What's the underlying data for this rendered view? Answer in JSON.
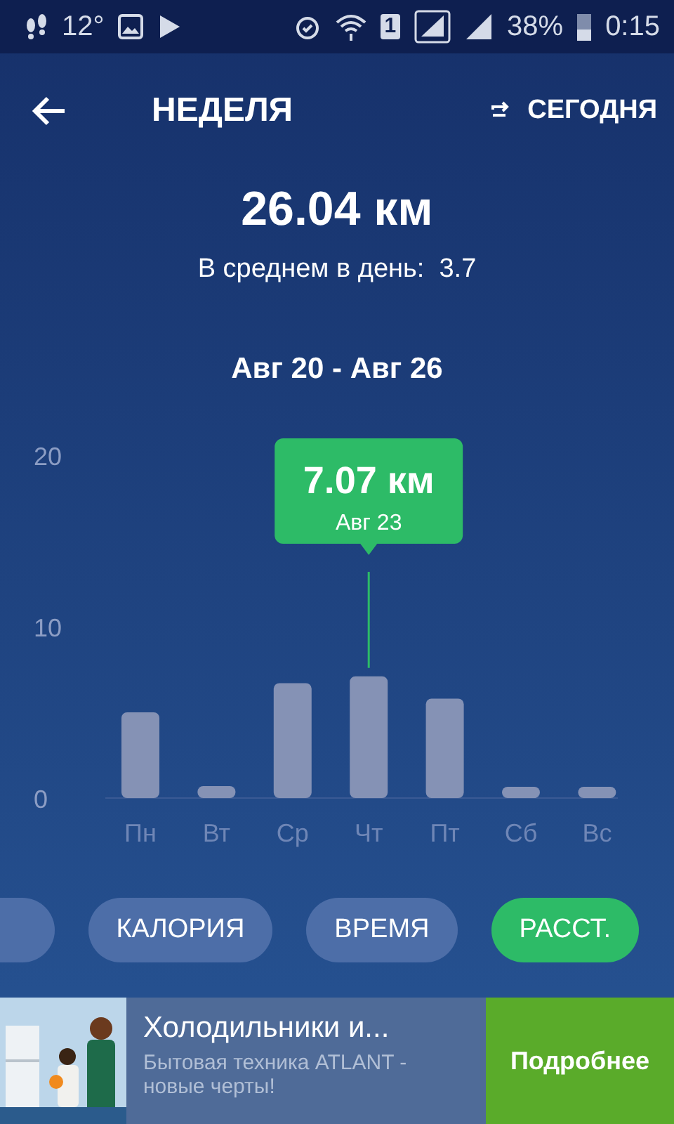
{
  "status_bar": {
    "temperature": "12°",
    "sim": "1",
    "battery": "38%",
    "time": "0:15"
  },
  "header": {
    "title": "НЕДЕЛЯ",
    "today_button": "СЕГОДНЯ"
  },
  "summary": {
    "total": "26.04 км",
    "average_label": "В среднем в день:",
    "average_value": "3.7"
  },
  "range": "Авг 20 - Авг 26",
  "chart": {
    "chart_data": {
      "type": "bar",
      "categories": [
        "Пн",
        "Вт",
        "Ср",
        "Чт",
        "Пт",
        "Сб",
        "Вс"
      ],
      "series": [
        {
          "color": "#8592b5",
          "values": [
            5.0,
            0.7,
            6.7,
            7.1,
            5.8,
            0.4,
            0.4
          ]
        }
      ],
      "ylim": [
        0,
        20
      ],
      "yticks": [
        0,
        10,
        20
      ],
      "annotations": [
        "7.07 км",
        "Авг 23"
      ]
    }
  },
  "metrics": [
    {
      "selected": false
    },
    {
      "label": "КАЛОРИЯ",
      "selected": false
    },
    {
      "label": "ВРЕМЯ",
      "selected": false
    },
    {
      "label": "РАССТ.",
      "selected": true
    }
  ],
  "ad": {
    "title": "Холодильники и...",
    "text": "Бытовая техника ATLANT - новые черты!",
    "button": "Подробнее"
  }
}
